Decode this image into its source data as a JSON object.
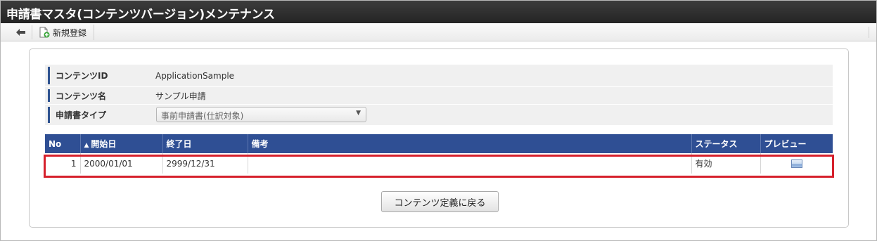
{
  "window": {
    "title": "申請書マスタ(コンテンツバージョン)メンテナンス"
  },
  "toolbar": {
    "back_icon": "arrow-left-icon",
    "new_icon": "document-add-icon",
    "new_label": "新規登録"
  },
  "form": {
    "content_id": {
      "label": "コンテンツID",
      "value": "ApplicationSample"
    },
    "content_name": {
      "label": "コンテンツ名",
      "value": "サンプル申請"
    },
    "form_type": {
      "label": "申請書タイプ",
      "selected": "事前申請書(仕訳対象)"
    }
  },
  "table": {
    "sort_indicator": "▲",
    "columns": {
      "no": "No",
      "start_date": "開始日",
      "end_date": "終了日",
      "remarks": "備考",
      "status": "ステータス",
      "preview": "プレビュー"
    },
    "rows": [
      {
        "no": "1",
        "start_date": "2000/01/01",
        "end_date": "2999/12/31",
        "remarks": "",
        "status": "有効",
        "preview_icon": "preview-icon"
      }
    ]
  },
  "actions": {
    "back_to_definition_label": "コンテンツ定義に戻る"
  },
  "colors": {
    "header_bar": "#2f4f94",
    "label_accent": "#2f5390",
    "highlight": "#d6202c",
    "title_bar": "#2b2b2b"
  }
}
